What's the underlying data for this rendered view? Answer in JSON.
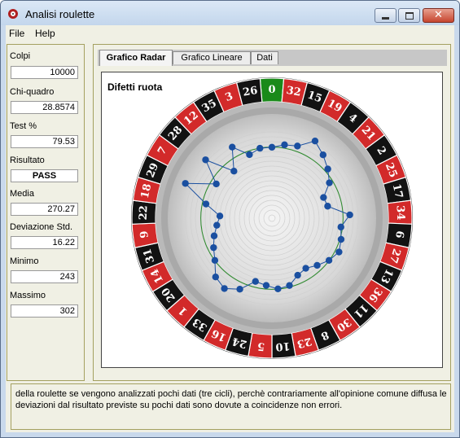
{
  "window": {
    "title": "Analisi roulette",
    "close_symbol": "✕"
  },
  "menu": [
    {
      "label": "File"
    },
    {
      "label": "Help"
    }
  ],
  "stats": {
    "colpi": {
      "label": "Colpi",
      "value": "10000"
    },
    "chi": {
      "label": "Chi-quadro",
      "value": "28.8574"
    },
    "test": {
      "label": "Test %",
      "value": "79.53"
    },
    "risultato": {
      "label": "Risultato",
      "value": "PASS"
    },
    "media": {
      "label": "Media",
      "value": "270.27"
    },
    "dev": {
      "label": "Deviazione Std.",
      "value": "16.22"
    },
    "minimo": {
      "label": "Minimo",
      "value": "243"
    },
    "massimo": {
      "label": "Massimo",
      "value": "302"
    }
  },
  "tabs": [
    {
      "label": "Grafico Radar",
      "active": true
    },
    {
      "label": "Grafico Lineare",
      "active": false
    },
    {
      "label": "Dati",
      "active": false
    }
  ],
  "chart_title": "Difetti ruota",
  "footer_text": "della roulette se vengono analizzati pochi dati (tre cicli), perchè contrariamente all'opinione comune diffusa le deviazioni dal risultato previste su pochi dati sono dovute a coincidenze non errori.",
  "colors": {
    "red": "#d22a2a",
    "black": "#121212",
    "green": "#1a8a1a",
    "point": "#1a4fa0",
    "mean_line": "#2b8a2b"
  },
  "chart_data": {
    "type": "radar",
    "wheel_numbers": [
      0,
      32,
      15,
      19,
      4,
      21,
      2,
      25,
      17,
      34,
      6,
      27,
      13,
      36,
      11,
      30,
      8,
      23,
      10,
      5,
      24,
      16,
      33,
      1,
      20,
      14,
      31,
      9,
      22,
      18,
      29,
      7,
      28,
      12,
      35,
      3,
      26
    ],
    "red_numbers": [
      1,
      3,
      5,
      7,
      9,
      12,
      14,
      16,
      18,
      19,
      21,
      23,
      25,
      27,
      30,
      32,
      34,
      36
    ],
    "values": [
      270,
      275,
      278,
      295,
      285,
      275,
      265,
      248,
      250,
      280,
      268,
      272,
      276,
      270,
      262,
      255,
      258,
      268,
      270,
      265,
      262,
      280,
      290,
      285,
      270,
      262,
      255,
      248,
      243,
      265,
      302,
      262,
      295,
      255,
      285,
      265,
      270
    ],
    "mean": 270.27,
    "range": [
      180,
      320
    ]
  }
}
